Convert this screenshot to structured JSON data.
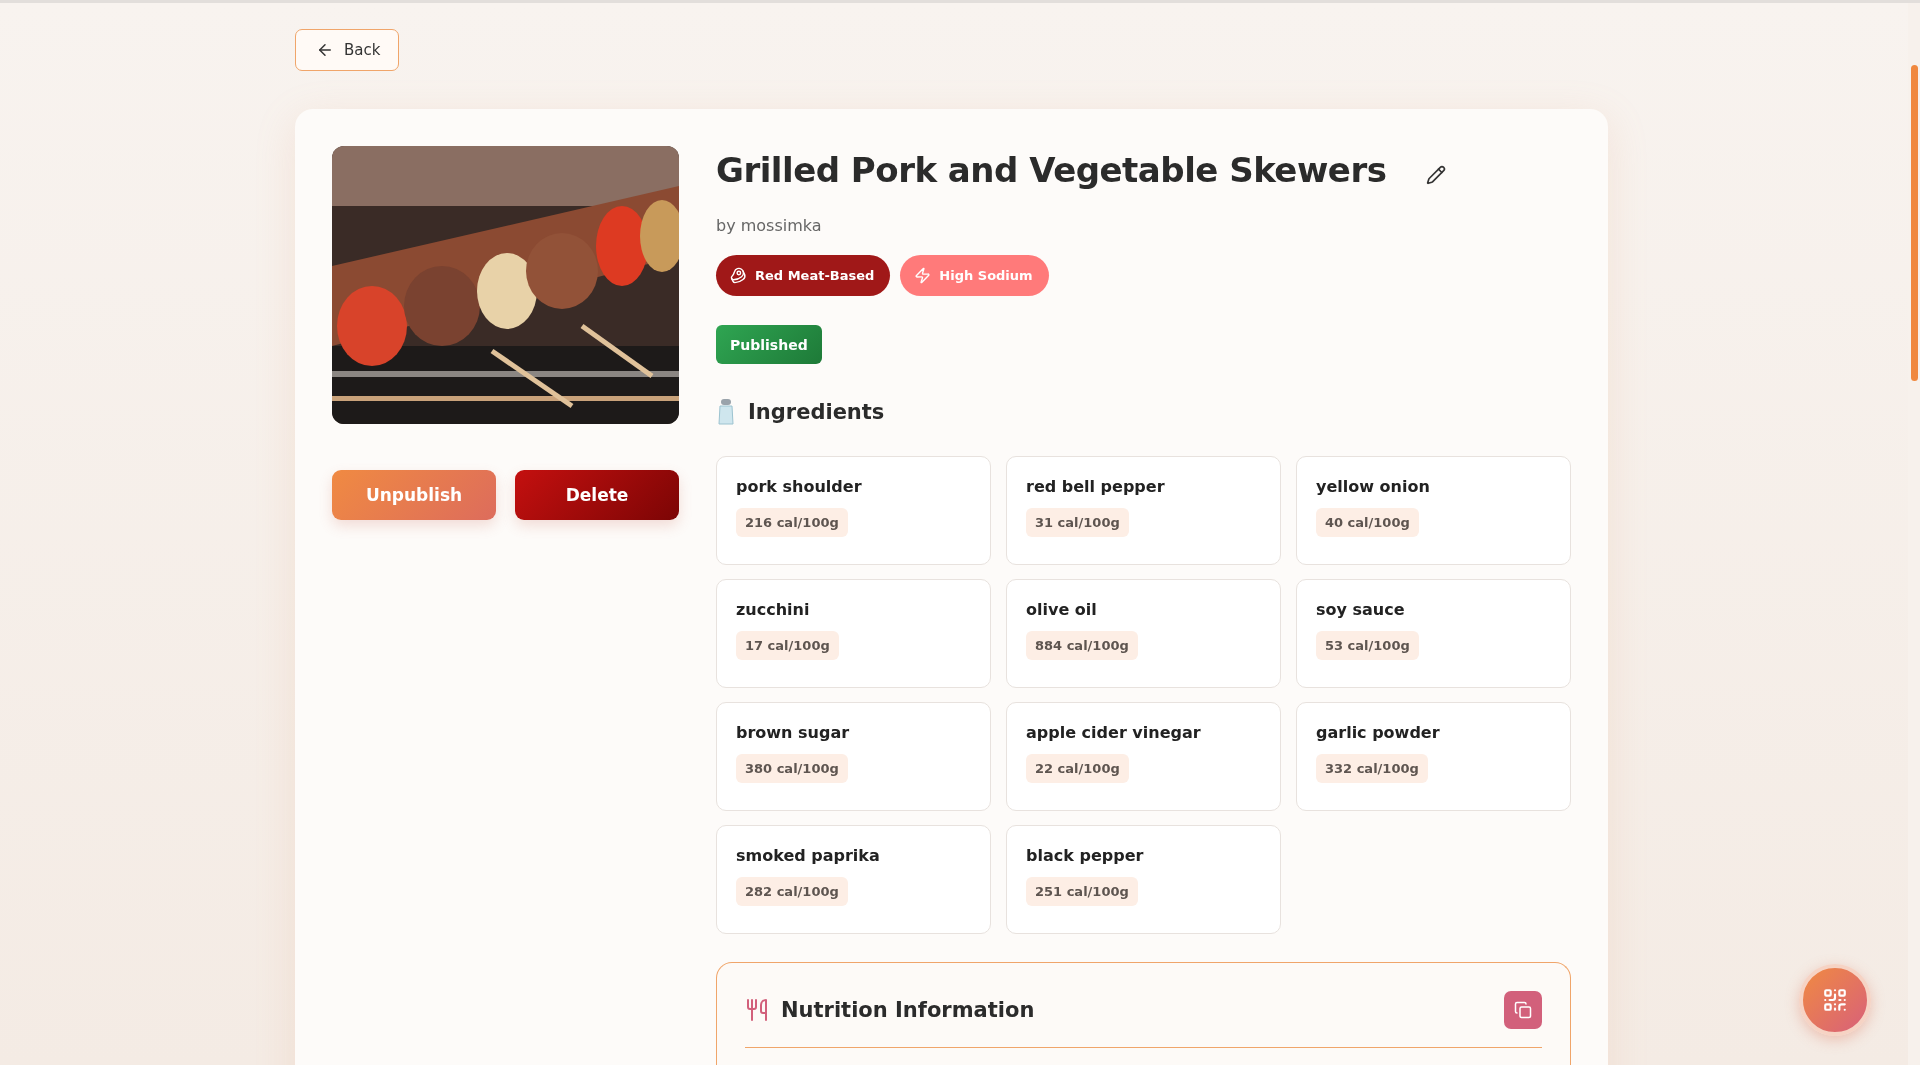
{
  "back_button": {
    "label": "Back"
  },
  "recipe": {
    "title": "Grilled Pork and Vegetable Skewers",
    "author": "by mossimka",
    "tags": [
      {
        "label": "Red Meat-Based",
        "kind": "meat",
        "color": "#a01818"
      },
      {
        "label": "High Sodium",
        "kind": "sodium",
        "color": "#ff7a7a"
      }
    ],
    "status": "Published"
  },
  "actions": [
    {
      "label": "Unpublish",
      "kind": "secondary"
    },
    {
      "label": "Delete",
      "kind": "danger"
    }
  ],
  "ingredients": {
    "title": "Ingredients",
    "items": [
      {
        "name": "pork shoulder",
        "calories": "216 cal/100g"
      },
      {
        "name": "red bell pepper",
        "calories": "31 cal/100g"
      },
      {
        "name": "yellow onion",
        "calories": "40 cal/100g"
      },
      {
        "name": "zucchini",
        "calories": "17 cal/100g"
      },
      {
        "name": "olive oil",
        "calories": "884 cal/100g"
      },
      {
        "name": "soy sauce",
        "calories": "53 cal/100g"
      },
      {
        "name": "brown sugar",
        "calories": "380 cal/100g"
      },
      {
        "name": "apple cider vinegar",
        "calories": "22 cal/100g"
      },
      {
        "name": "garlic powder",
        "calories": "332 cal/100g"
      },
      {
        "name": "smoked paprika",
        "calories": "282 cal/100g"
      },
      {
        "name": "black pepper",
        "calories": "251 cal/100g"
      }
    ]
  },
  "nutrition": {
    "title": "Nutrition Information"
  }
}
